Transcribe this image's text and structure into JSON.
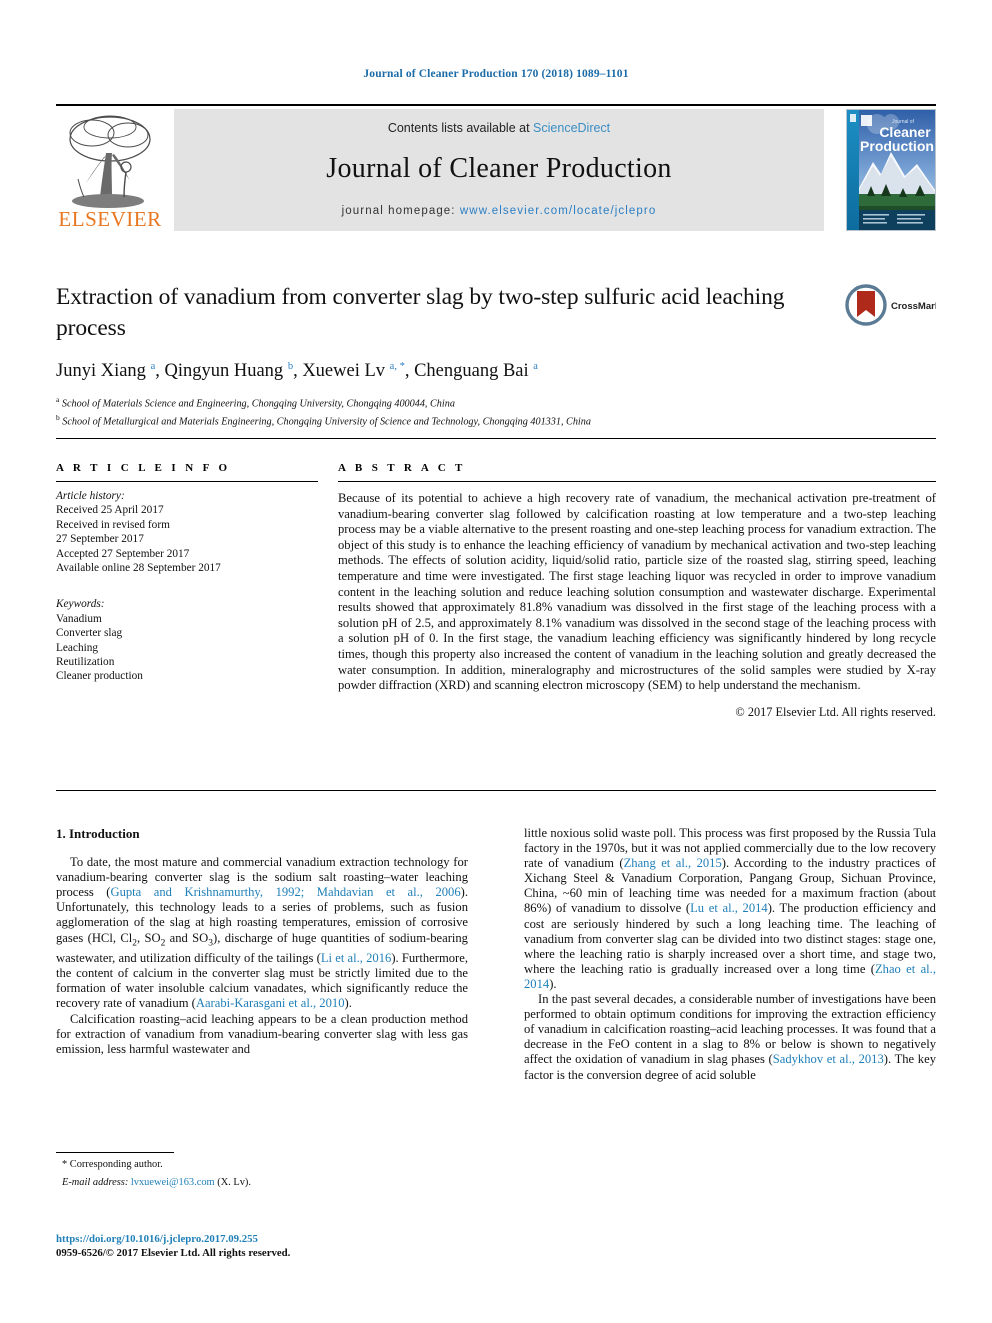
{
  "running_head": "Journal of Cleaner Production 170 (2018) 1089–1101",
  "masthead": {
    "contents_prefix": "Contents lists available at",
    "sciencedirect": "ScienceDirect",
    "journal_title": "Journal of Cleaner Production",
    "homepage_label": "journal homepage:",
    "homepage_url": "www.elsevier.com/locate/jclepro",
    "publisher_logo_text": "ELSEVIER",
    "cover_title_line1": "Journal of",
    "cover_title_line2": "Cleaner",
    "cover_title_line3": "Production"
  },
  "badge": {
    "crossmark_label": "CrossMark"
  },
  "article": {
    "title": "Extraction of vanadium from converter slag by two-step sulfuric acid leaching process",
    "authors_html": "Junyi Xiang <sup>a</sup>, Qingyun Huang <sup>b</sup>, Xuewei Lv <sup>a, *</sup>, Chenguang Bai <sup>a</sup>",
    "affiliation_a": "School of Materials Science and Engineering, Chongqing University, Chongqing 400044, China",
    "affiliation_b": "School of Metallurgical and Materials Engineering, Chongqing University of Science and Technology, Chongqing 401331, China"
  },
  "article_info": {
    "heading": "A R T I C L E  I N F O",
    "history_label": "Article history:",
    "received": "Received 25 April 2017",
    "revised_label": "Received in revised form",
    "revised_date": "27 September 2017",
    "accepted": "Accepted 27 September 2017",
    "available": "Available online 28 September 2017",
    "keywords_label": "Keywords:",
    "keywords": [
      "Vanadium",
      "Converter slag",
      "Leaching",
      "Reutilization",
      "Cleaner production"
    ]
  },
  "abstract": {
    "heading": "A B S T R A C T",
    "text": "Because of its potential to achieve a high recovery rate of vanadium, the mechanical activation pre-treatment of vanadium-bearing converter slag followed by calcification roasting at low temperature and a two-step leaching process may be a viable alternative to the present roasting and one-step leaching process for vanadium extraction. The object of this study is to enhance the leaching efficiency of vanadium by mechanical activation and two-step leaching methods. The effects of solution acidity, liquid/solid ratio, particle size of the roasted slag, stirring speed, leaching temperature and time were investigated. The first stage leaching liquor was recycled in order to improve vanadium content in the leaching solution and reduce leaching solution consumption and wastewater discharge. Experimental results showed that approximately 81.8% vanadium was dissolved in the first stage of the leaching process with a solution pH of 2.5, and approximately 8.1% vanadium was dissolved in the second stage of the leaching process with a solution pH of 0. In the first stage, the vanadium leaching efficiency was significantly hindered by long recycle times, though this property also increased the content of vanadium in the leaching solution and greatly decreased the water consumption. In addition, mineralography and microstructures of the solid samples were studied by X-ray powder diffraction (XRD) and scanning electron microscopy (SEM) to help understand the mechanism.",
    "copyright": "© 2017 Elsevier Ltd. All rights reserved."
  },
  "body": {
    "section_heading": "1. Introduction",
    "left_paragraph_1_html": "To date, the most mature and commercial vanadium extraction technology for vanadium-bearing converter slag is the sodium salt roasting&ndash;water leaching process (<span class=\"cite\">Gupta and Krishnamurthy, 1992; Mahdavian et al., 2006</span>). Unfortunately, this technology leads to a series of problems, such as fusion agglomeration of the slag at high roasting temperatures, emission of corrosive gases (HCl, Cl<sub>2</sub>, SO<sub>2</sub> and SO<sub>3</sub>), discharge of huge quantities of sodium-bearing wastewater, and utilization difficulty of the tailings (<span class=\"cite\">Li et al., 2016</span>). Furthermore, the content of calcium in the converter slag must be strictly limited due to the formation of water insoluble calcium vanadates, which significantly reduce the recovery rate of vanadium (<span class=\"cite\">Aarabi-Karasgani et al., 2010</span>).",
    "left_paragraph_2_html": "Calcification roasting&ndash;acid leaching appears to be a clean production method for extraction of vanadium from vanadium-bearing converter slag with less gas emission, less harmful wastewater and",
    "right_paragraph_1_html": "little noxious solid waste poll. This process was first proposed by the Russia Tula factory in the 1970s, but it was not applied commercially due to the low recovery rate of vanadium (<span class=\"cite\">Zhang et al., 2015</span>). According to the industry practices of Xichang Steel &amp; Vanadium Corporation, Pangang Group, Sichuan Province, China, ~60 min of leaching time was needed for a maximum fraction (about 86%) of vanadium to dissolve (<span class=\"cite\">Lu et al., 2014</span>). The production efficiency and cost are seriously hindered by such a long leaching time. The leaching of vanadium from converter slag can be divided into two distinct stages: stage one, where the leaching ratio is sharply increased over a short time, and stage two, where the leaching ratio is gradually increased over a long time (<span class=\"cite\">Zhao et al., 2014</span>).",
    "right_paragraph_2_html": "In the past several decades, a considerable number of investigations have been performed to obtain optimum conditions for improving the extraction efficiency of vanadium in calcification roasting&ndash;acid leaching processes. It was found that a decrease in the FeO content in a slag to 8% or below is shown to negatively affect the oxidation of vanadium in slag phases (<span class=\"cite\">Sadykhov et al., 2013</span>). The key factor is the conversion degree of acid soluble"
  },
  "footnotes": {
    "corresponding_author": "* Corresponding author.",
    "email_label": "E-mail address:",
    "email": "lvxuewei@163.com",
    "email_suffix": "(X. Lv).",
    "doi": "https://doi.org/10.1016/j.jclepro.2017.09.255",
    "issn_line": "0959-6526/© 2017 Elsevier Ltd. All rights reserved."
  },
  "colors": {
    "link_blue": "#1f7fb8",
    "header_blue": "#1a6ba8",
    "elsevier_orange": "#e87722",
    "band_grey": "#e3e3e3",
    "crossmark_red": "#b02a1c"
  }
}
